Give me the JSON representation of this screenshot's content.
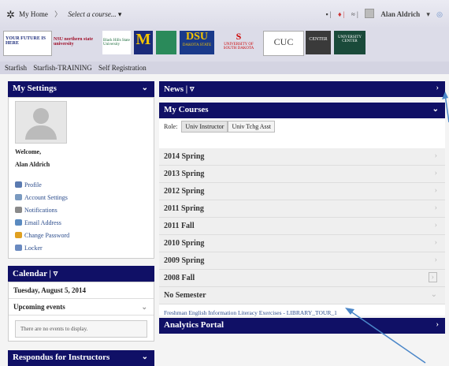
{
  "topbar": {
    "home": "My Home",
    "crumb": "Select a course...",
    "user": "Alan Aldrich"
  },
  "logos": {
    "l1": "YOUR FUTURE IS HERE",
    "l2": "NSU northern state university",
    "l3": "Black Hills State University",
    "l4": "M",
    "l5": "DSU",
    "l6": "DAKOTA STATE",
    "l7": "UNIVERSITY OF SOUTH DAKOTA",
    "l8": "CUC",
    "l9": "CENTER",
    "l10": "UNIVERSITY CENTER"
  },
  "links": [
    "Starfish",
    "Starfish-TRAINING",
    "Self Registration"
  ],
  "settings": {
    "title": "My Settings",
    "welcome": "Welcome,",
    "name": "Alan Aldrich",
    "items": [
      "Profile",
      "Account Settings",
      "Notifications",
      "Email Address",
      "Change Password",
      "Locker"
    ]
  },
  "calendar": {
    "title": "Calendar |",
    "date": "Tuesday, August 5, 2014",
    "upcoming": "Upcoming events",
    "empty": "There are no events to display."
  },
  "respondus": {
    "title": "Respondus for Instructors"
  },
  "news": {
    "title": "News |"
  },
  "courses": {
    "title": "My Courses",
    "role_label": "Role:",
    "roles": [
      "Univ Instructor",
      "Univ Tchg Asst"
    ],
    "terms": [
      "2014 Spring",
      "2013 Spring",
      "2012 Spring",
      "2011 Spring",
      "2011 Fall",
      "2010 Spring",
      "2009 Spring",
      "2008 Fall",
      "No Semester"
    ],
    "course_link": "Freshman English Information Literacy Exercises - LIBRARY_TOUR_1"
  },
  "analytics": {
    "title": "Analytics Portal"
  },
  "colors": {
    "nav": "#101066",
    "link": "#2b4c8c",
    "arrow": "#4a86c8"
  }
}
